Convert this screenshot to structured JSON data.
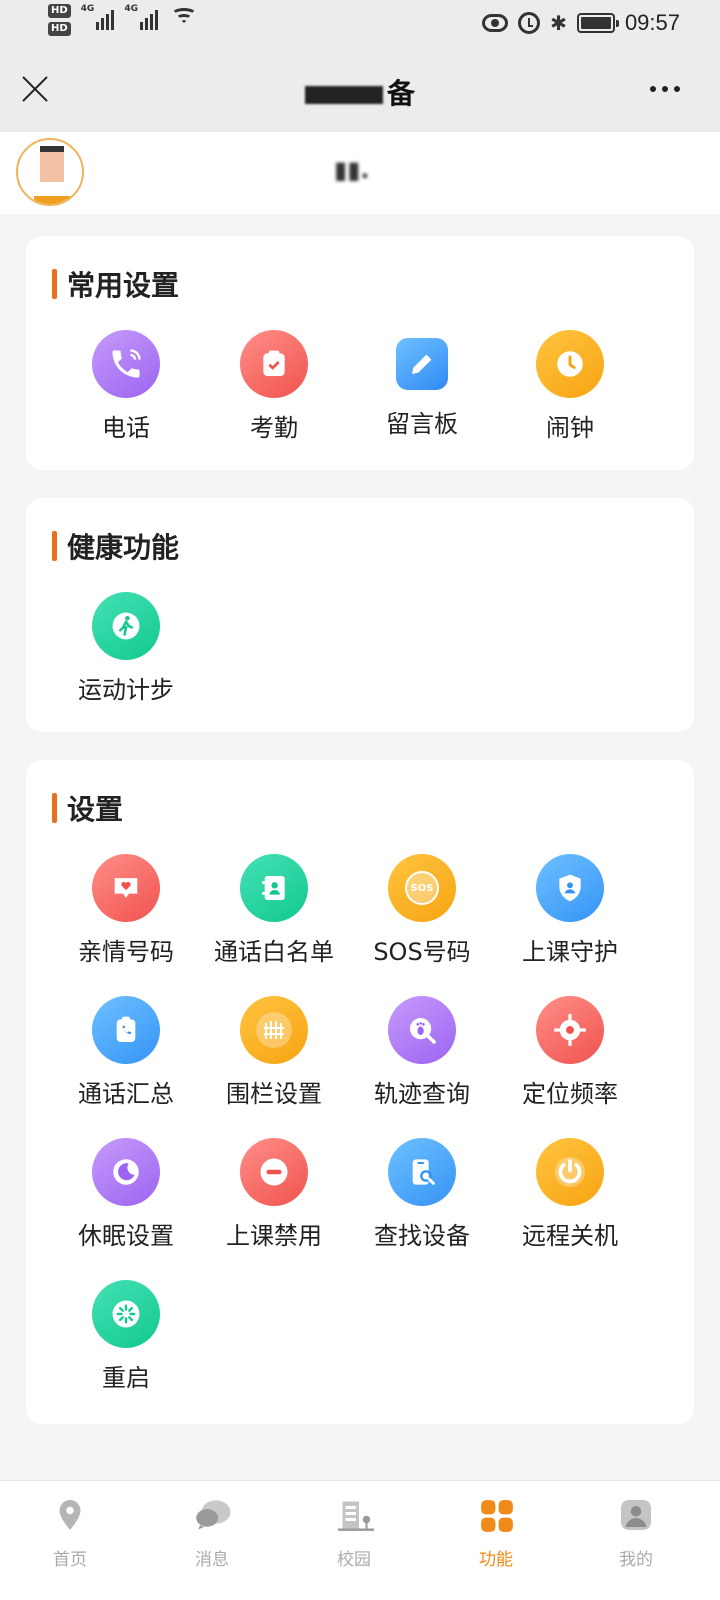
{
  "status_bar": {
    "hd1": "HD",
    "hd2": "HD",
    "net1": "4G",
    "net2": "4G",
    "time": "09:57",
    "bluetooth_glyph": "✱"
  },
  "header": {
    "title_visible": "备"
  },
  "profile": {
    "name_visible": "▮▮."
  },
  "sections": [
    {
      "title": "常用设置",
      "items": [
        {
          "label": "电话",
          "icon": "phone-icon",
          "color": "purple"
        },
        {
          "label": "考勤",
          "icon": "attendance-clipboard-icon",
          "color": "red"
        },
        {
          "label": "留言板",
          "icon": "pencil-note-icon",
          "color": "blue-square"
        },
        {
          "label": "闹钟",
          "icon": "alarm-clock-icon",
          "color": "orange"
        }
      ]
    },
    {
      "title": "健康功能",
      "items": [
        {
          "label": "运动计步",
          "icon": "walking-person-icon",
          "color": "green"
        }
      ]
    },
    {
      "title": "设置",
      "items": [
        {
          "label": "亲情号码",
          "icon": "heart-message-icon",
          "color": "red"
        },
        {
          "label": "通话白名单",
          "icon": "contact-book-icon",
          "color": "green"
        },
        {
          "label": "SOS号码",
          "icon": "sos-icon",
          "color": "orange",
          "icon_text": "SOS"
        },
        {
          "label": "上课守护",
          "icon": "shield-user-icon",
          "color": "blue"
        },
        {
          "label": "通话汇总",
          "icon": "call-log-icon",
          "color": "blue"
        },
        {
          "label": "围栏设置",
          "icon": "fence-icon",
          "color": "orange"
        },
        {
          "label": "轨迹查询",
          "icon": "footprint-search-icon",
          "color": "purple"
        },
        {
          "label": "定位频率",
          "icon": "locate-target-icon",
          "color": "red"
        },
        {
          "label": "休眠设置",
          "icon": "sleep-moon-icon",
          "color": "purple"
        },
        {
          "label": "上课禁用",
          "icon": "no-entry-icon",
          "color": "red"
        },
        {
          "label": "查找设备",
          "icon": "find-device-icon",
          "color": "blue"
        },
        {
          "label": "远程关机",
          "icon": "power-icon",
          "color": "orange"
        },
        {
          "label": "重启",
          "icon": "restart-icon",
          "color": "green"
        }
      ]
    }
  ],
  "tabbar": {
    "tabs": [
      {
        "label": "首页",
        "icon": "home-location-icon",
        "active": false
      },
      {
        "label": "消息",
        "icon": "message-bubble-icon",
        "active": false
      },
      {
        "label": "校园",
        "icon": "school-building-icon",
        "active": false
      },
      {
        "label": "功能",
        "icon": "function-grid-icon",
        "active": true
      },
      {
        "label": "我的",
        "icon": "profile-icon",
        "active": false
      }
    ]
  },
  "colors": {
    "accent": "#e8711b",
    "active_tab": "#f08a18",
    "inactive_tab": "#aaaaaa",
    "page_bg": "#f5f5f5"
  }
}
